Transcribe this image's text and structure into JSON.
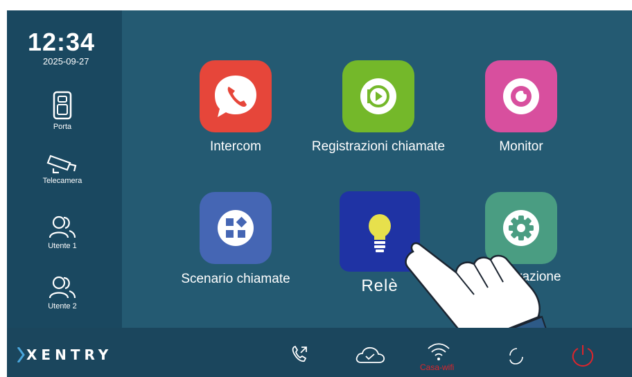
{
  "status": {
    "time": "12:34",
    "date": "2025-09-27"
  },
  "sidebar": {
    "items": [
      {
        "label": "Porta"
      },
      {
        "label": "Telecamera"
      },
      {
        "label": "Utente 1"
      },
      {
        "label": "Utente 2"
      }
    ]
  },
  "apps": {
    "intercom": {
      "label": "Intercom",
      "color": "#e6463a"
    },
    "registrazioni": {
      "label": "Registrazioni chiamate",
      "color": "#74b82a"
    },
    "monitor": {
      "label": "Monitor",
      "color": "#d84f9e"
    },
    "scenario": {
      "label": "Scenario chiamate",
      "color": "#4566b4"
    },
    "rele": {
      "label": "Relè",
      "color": "#1f33a4"
    },
    "configurazione": {
      "label": "nfigurazione",
      "color": "#4a9d82"
    }
  },
  "bottom_bar": {
    "logo": "XENTRY",
    "wifi_label": "Casa-wifi",
    "icons": [
      "call-log-icon",
      "cloud-check-icon",
      "wifi-icon",
      "refresh-icon",
      "power-icon"
    ]
  }
}
